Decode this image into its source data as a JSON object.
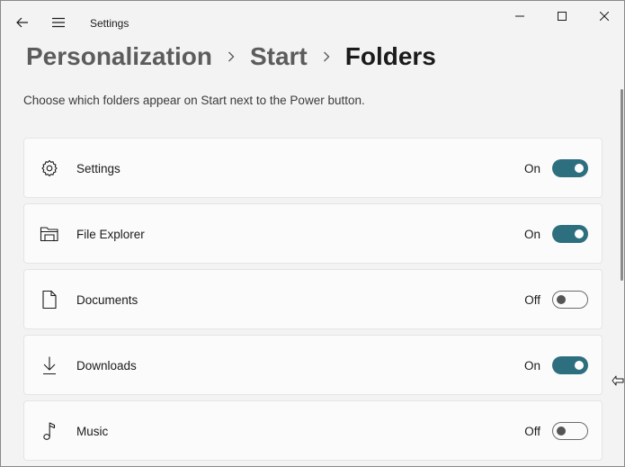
{
  "window": {
    "title": "Settings"
  },
  "breadcrumb": [
    "Personalization",
    "Start",
    "Folders"
  ],
  "description": "Choose which folders appear on Start next to the Power button.",
  "accent_color": "#2d6f7e",
  "folders": [
    {
      "label": "Settings",
      "state": "On",
      "icon": "gear-icon"
    },
    {
      "label": "File Explorer",
      "state": "On",
      "icon": "folder-icon"
    },
    {
      "label": "Documents",
      "state": "Off",
      "icon": "document-icon"
    },
    {
      "label": "Downloads",
      "state": "On",
      "icon": "download-icon"
    },
    {
      "label": "Music",
      "state": "Off",
      "icon": "music-note-icon"
    }
  ]
}
